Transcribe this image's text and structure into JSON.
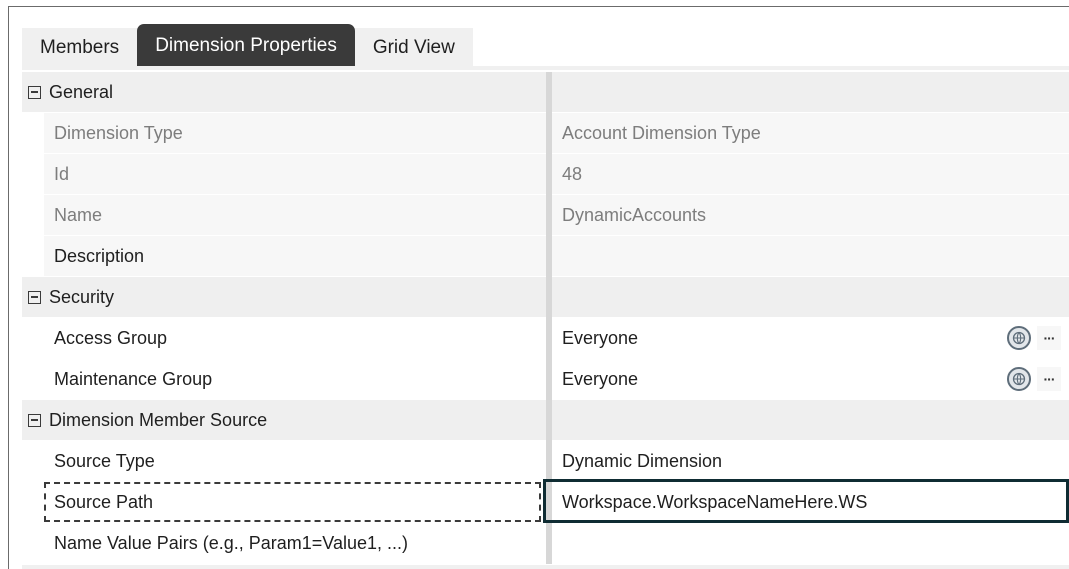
{
  "tabs": [
    {
      "label": "Members",
      "active": false
    },
    {
      "label": "Dimension Properties",
      "active": true
    },
    {
      "label": "Grid View",
      "active": false
    }
  ],
  "sections": {
    "general": {
      "label": "General",
      "rows": {
        "dimension_type": {
          "name": "Dimension Type",
          "value": "Account Dimension Type"
        },
        "id": {
          "name": "Id",
          "value": "48"
        },
        "name": {
          "name": "Name",
          "value": "DynamicAccounts"
        },
        "description": {
          "name": "Description",
          "value": ""
        }
      }
    },
    "security": {
      "label": "Security",
      "rows": {
        "access_group": {
          "name": "Access Group",
          "value": "Everyone"
        },
        "maintenance_group": {
          "name": "Maintenance Group",
          "value": "Everyone"
        }
      }
    },
    "member_source": {
      "label": "Dimension Member Source",
      "rows": {
        "source_type": {
          "name": "Source Type",
          "value": "Dynamic Dimension"
        },
        "source_path": {
          "name": "Source Path",
          "value": "Workspace.WorkspaceNameHere.WS"
        },
        "name_value_pairs": {
          "name": "Name Value Pairs (e.g., Param1=Value1, ...)",
          "value": ""
        }
      }
    }
  },
  "icons": {
    "globe": "globe-icon",
    "ellipsis": "ellipsis-icon",
    "collapse": "collapse-icon"
  },
  "colors": {
    "active_tab": "#3a3a3a",
    "category_bg": "#efefef",
    "readonly_text": "#7d7d7d",
    "selection_border": "#0f2c33"
  }
}
